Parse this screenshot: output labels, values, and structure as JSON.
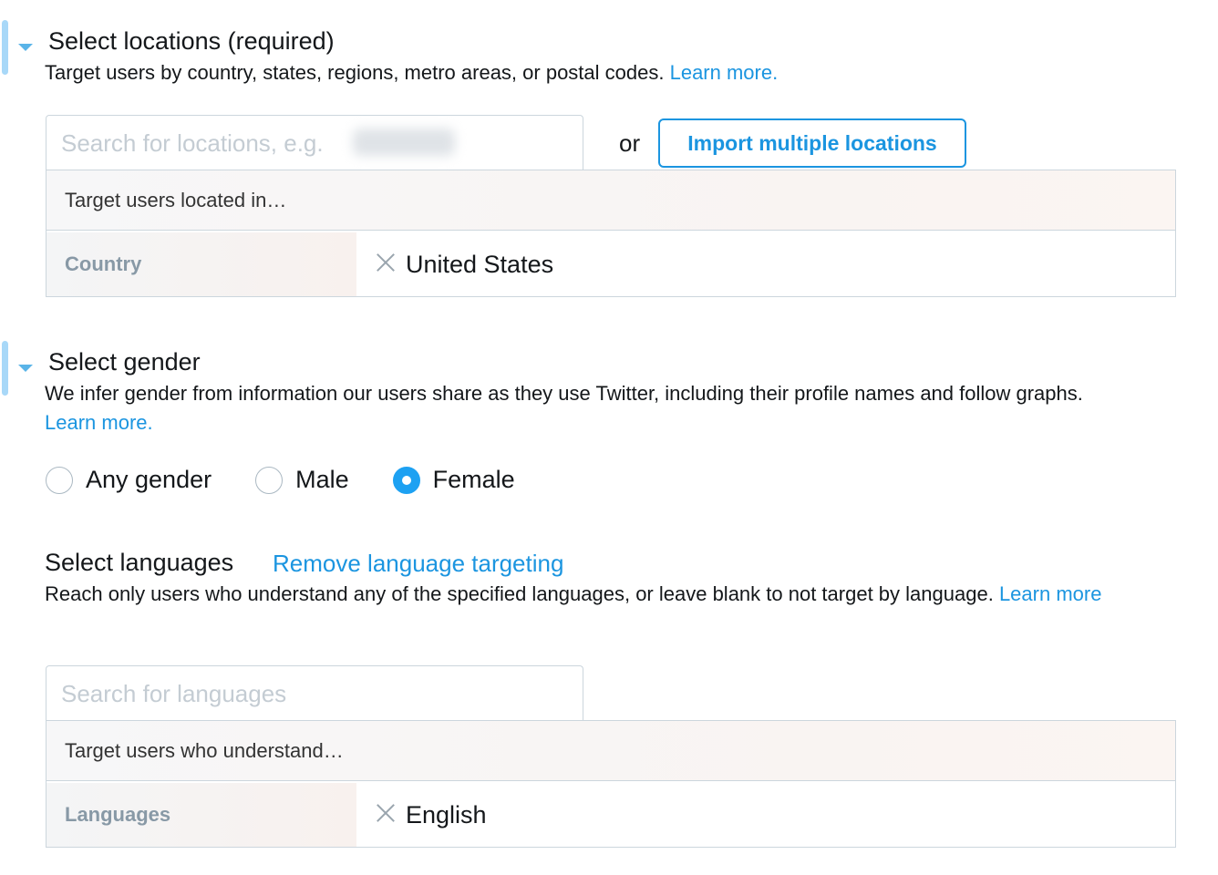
{
  "locations": {
    "title": "Select locations (required)",
    "description": "Target users by country, states, regions, metro areas, or postal codes.",
    "learn_more": "Learn more.",
    "search_placeholder": "Search for locations, e.g.",
    "or_text": "or",
    "import_button": "Import multiple locations",
    "panel_header": "Target users located in…",
    "row_label": "Country",
    "selected": "United States"
  },
  "gender": {
    "title": "Select gender",
    "description": "We infer gender from information our users share as they use Twitter, including their profile names and follow graphs.",
    "learn_more": "Learn more.",
    "options": [
      {
        "label": "Any gender",
        "checked": false
      },
      {
        "label": "Male",
        "checked": false
      },
      {
        "label": "Female",
        "checked": true
      }
    ]
  },
  "languages": {
    "title": "Select languages",
    "remove_link": "Remove language targeting",
    "description": "Reach only users who understand any of the specified languages, or leave blank to not target by language.",
    "learn_more": "Learn more",
    "search_placeholder": "Search for languages",
    "panel_header": "Target users who understand…",
    "row_label": "Languages",
    "selected": "English"
  },
  "colors": {
    "link": "#1b95e0",
    "radio_checked": "#1da1f2",
    "section_bar": "#a8d8f8"
  }
}
